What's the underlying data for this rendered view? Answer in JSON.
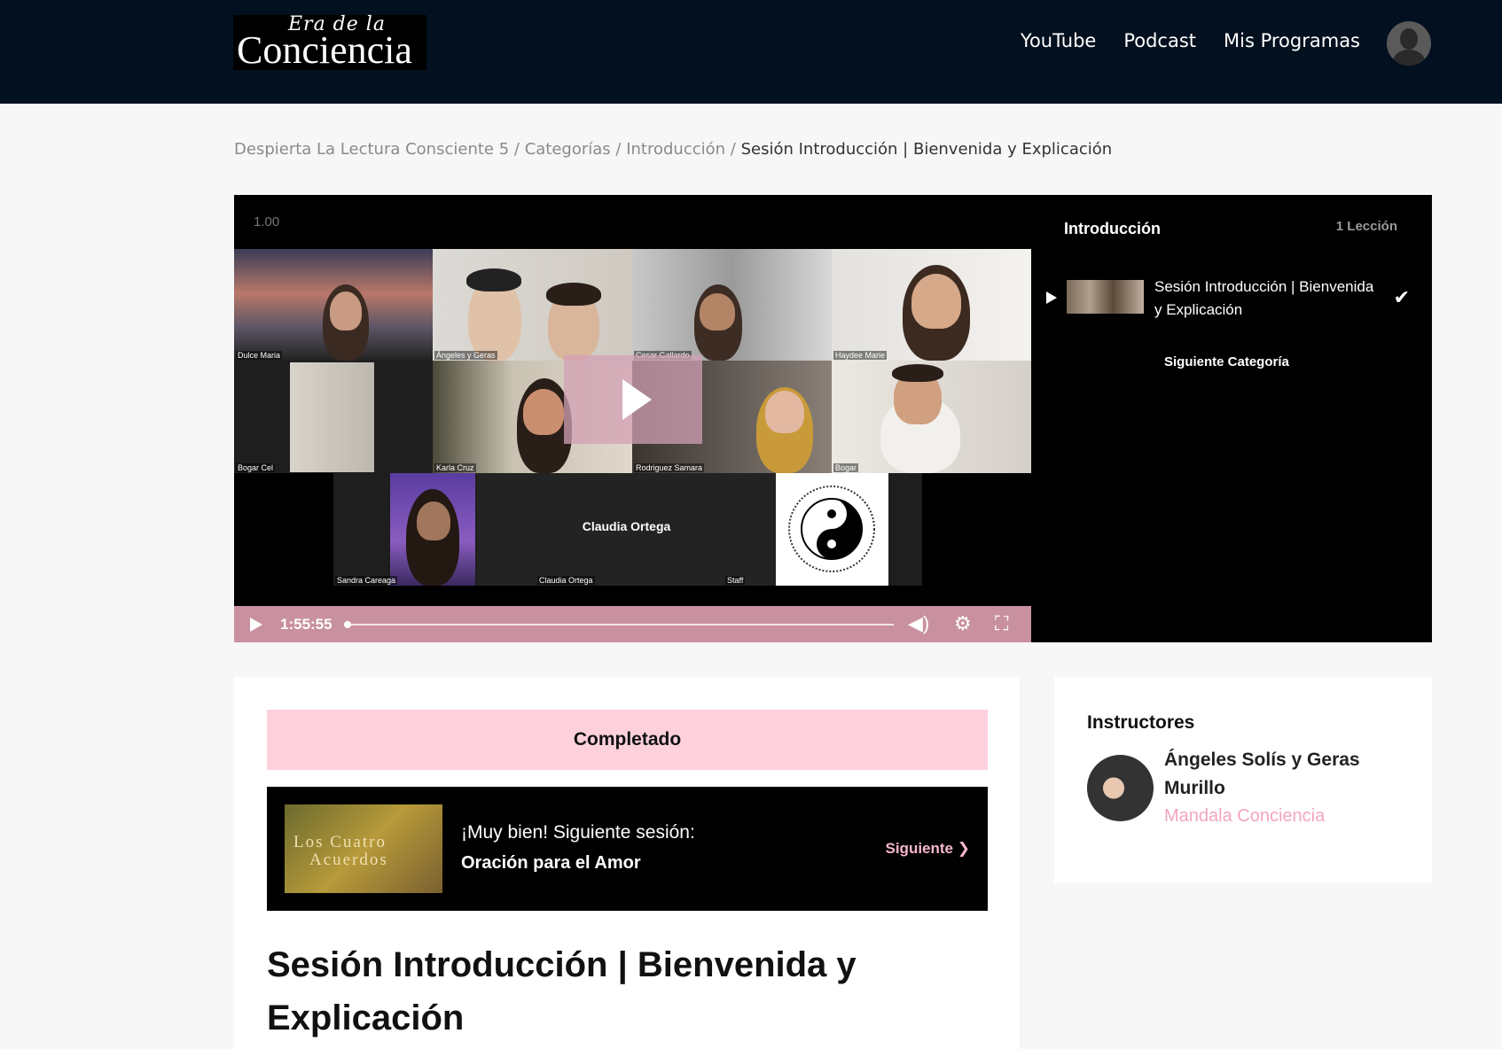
{
  "header": {
    "logo_script": "Era de la",
    "logo_word": "Conciencia",
    "nav": [
      "YouTube",
      "Podcast",
      "Mis Programas"
    ]
  },
  "breadcrumb": {
    "items": [
      "Despierta La Lectura Consciente 5",
      "Categorías",
      "Introducción"
    ],
    "current": "Sesión Introducción | Bienvenida y Explicación",
    "separator": "/"
  },
  "video": {
    "speed": "1.00",
    "time": "1:55:55",
    "participants": [
      "Dulce Maria",
      "Ángeles y Geras",
      "Cesar Gallardo",
      "Haydee Marie",
      "Bogar Cel",
      "Karla Cruz",
      "Rodriguez Samara",
      "Bogar",
      "Sandra Careaga",
      "Claudia Ortega",
      "Staff"
    ],
    "center_name": "Claudia Ortega"
  },
  "playlist": {
    "title": "Introducción",
    "count": "1 Lección",
    "item_title": "Sesión Introducción | Bienvenida y Explicación",
    "next_category": "Siguiente Categoría"
  },
  "main": {
    "completed_label": "Completado",
    "next_intro": "¡Muy bien! Siguiente sesión:",
    "next_title": "Oración para el Amor",
    "next_button": "Siguiente",
    "book_line1": "Los Cuatro",
    "book_line2": "Acuerdos",
    "heading": "Sesión Introducción | Bienvenida y Explicación"
  },
  "instructors": {
    "title": "Instructores",
    "name": "Ángeles Solís y Geras Murillo",
    "org": "Mandala Conciencia"
  },
  "colors": {
    "header_bg": "#03101f",
    "accent_pink": "#fdd0dc",
    "control_bar": "#c9919f",
    "link_pink": "#f3a5bd"
  }
}
